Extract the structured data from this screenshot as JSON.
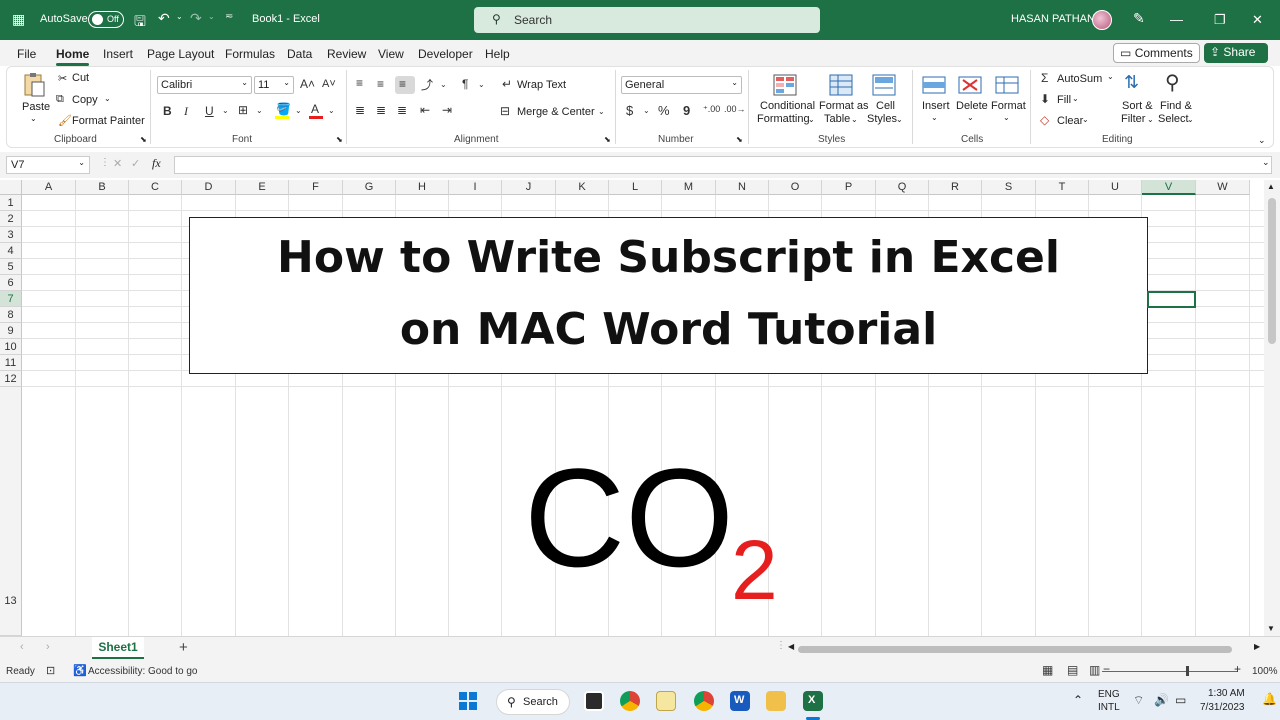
{
  "titlebar": {
    "autosave_label": "AutoSave",
    "toggle_state": "Off",
    "filename": "Book1  -  Excel",
    "search_placeholder": "Search",
    "user_name": "HASAN PATHAN",
    "accent_color": "#1e7145"
  },
  "menu": {
    "items": [
      "File",
      "Home",
      "Insert",
      "Page Layout",
      "Formulas",
      "Data",
      "Review",
      "View",
      "Developer",
      "Help"
    ],
    "active": "Home",
    "comments_label": "Comments",
    "share_label": "Share"
  },
  "ribbon": {
    "clipboard": {
      "paste": "Paste",
      "cut": "Cut",
      "copy": "Copy",
      "format_painter": "Format Painter",
      "group": "Clipboard"
    },
    "font": {
      "name": "Calibri",
      "size": "11",
      "bold": "B",
      "italic": "I",
      "underline": "U",
      "group": "Font"
    },
    "alignment": {
      "wrap_text": "Wrap Text",
      "merge_center": "Merge & Center",
      "group": "Alignment"
    },
    "number": {
      "format": "General",
      "currency": "$",
      "percent": "%",
      "comma": "9",
      "group": "Number"
    },
    "styles": {
      "conditional_1": "Conditional",
      "conditional_2": "Formatting",
      "format_table_1": "Format as",
      "format_table_2": "Table",
      "cell_styles_1": "Cell",
      "cell_styles_2": "Styles",
      "group": "Styles"
    },
    "cells": {
      "insert": "Insert",
      "delete": "Delete",
      "format": "Format",
      "group": "Cells"
    },
    "editing": {
      "autosum": "AutoSum",
      "fill": "Fill",
      "clear": "Clear",
      "sort_1": "Sort &",
      "sort_2": "Filter",
      "find_1": "Find &",
      "find_2": "Select",
      "group": "Editing"
    }
  },
  "formula_bar": {
    "name_box": "V7",
    "fx_label": "fx",
    "value": ""
  },
  "grid": {
    "columns": [
      "A",
      "B",
      "C",
      "D",
      "E",
      "F",
      "G",
      "H",
      "I",
      "J",
      "K",
      "L",
      "M",
      "N",
      "O",
      "P",
      "Q",
      "R",
      "S",
      "T",
      "U",
      "V",
      "W"
    ],
    "rows": [
      "1",
      "2",
      "3",
      "4",
      "5",
      "6",
      "7",
      "8",
      "9",
      "10",
      "11",
      "12",
      "13"
    ],
    "selected_column": "V",
    "selected_row": "7",
    "title_line1": "How to Write Subscript in Excel",
    "title_line2": "on MAC Word Tutorial",
    "formula_main": "CO",
    "formula_sub": "2",
    "sub_color": "#e61e1e"
  },
  "sheets": {
    "active": "Sheet1",
    "add_label": "+"
  },
  "status": {
    "ready": "Ready",
    "accessibility": "Accessibility: Good to go",
    "zoom": "100%"
  },
  "taskbar": {
    "search_label": "Search",
    "lang_1": "ENG",
    "lang_2": "INTL",
    "time": "1:30 AM",
    "date": "7/31/2023"
  }
}
